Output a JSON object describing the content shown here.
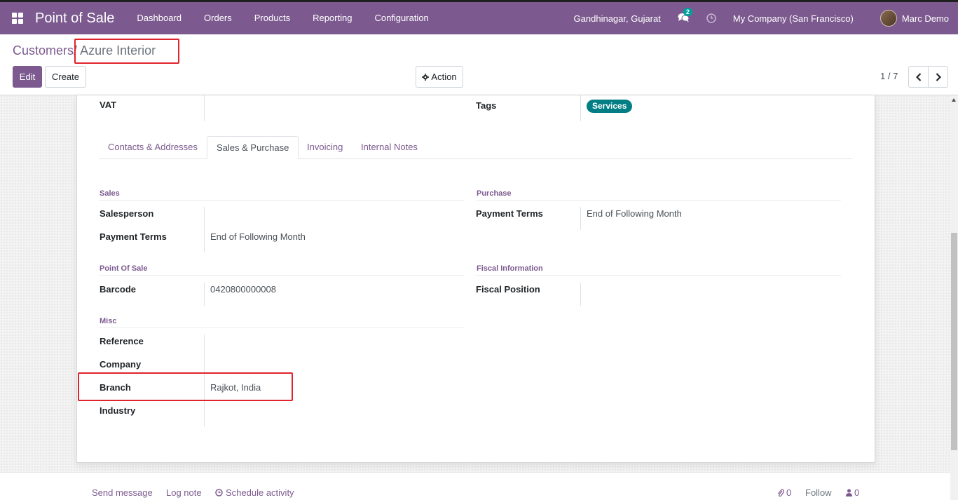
{
  "navbar": {
    "brand": "Point of Sale",
    "menu": [
      "Dashboard",
      "Orders",
      "Products",
      "Reporting",
      "Configuration"
    ],
    "branch": "Gandhinagar, Gujarat",
    "chat_badge": "2",
    "company": "My Company (San Francisco)",
    "user": "Marc Demo"
  },
  "breadcrumb": {
    "parent": "Customers",
    "separator": "/",
    "current": "Azure Interior"
  },
  "buttons": {
    "edit": "Edit",
    "create": "Create",
    "action": "Action"
  },
  "pager": {
    "value": "1 / 7"
  },
  "form": {
    "vat_label": "VAT",
    "vat_value": "",
    "tags_label": "Tags",
    "tags": [
      "Services"
    ],
    "tabs": [
      "Contacts & Addresses",
      "Sales & Purchase",
      "Invoicing",
      "Internal Notes"
    ],
    "active_tab": "Sales & Purchase",
    "sales": {
      "title": "Sales",
      "salesperson_label": "Salesperson",
      "salesperson_value": "",
      "payment_terms_label": "Payment Terms",
      "payment_terms_value": "End of Following Month"
    },
    "purchase": {
      "title": "Purchase",
      "payment_terms_label": "Payment Terms",
      "payment_terms_value": "End of Following Month"
    },
    "pos": {
      "title": "Point Of Sale",
      "barcode_label": "Barcode",
      "barcode_value": "0420800000008"
    },
    "fiscal": {
      "title": "Fiscal Information",
      "position_label": "Fiscal Position",
      "position_value": ""
    },
    "misc": {
      "title": "Misc",
      "reference_label": "Reference",
      "company_label": "Company",
      "branch_label": "Branch",
      "branch_value": "Rajkot, India",
      "industry_label": "Industry"
    }
  },
  "chatter": {
    "send_message": "Send message",
    "log_note": "Log note",
    "schedule_activity": "Schedule activity",
    "attachments": "0",
    "follow": "Follow",
    "followers": "0"
  },
  "colors": {
    "brand": "#7c5a8f",
    "tag": "#017e84",
    "highlight": "#e0242c"
  }
}
